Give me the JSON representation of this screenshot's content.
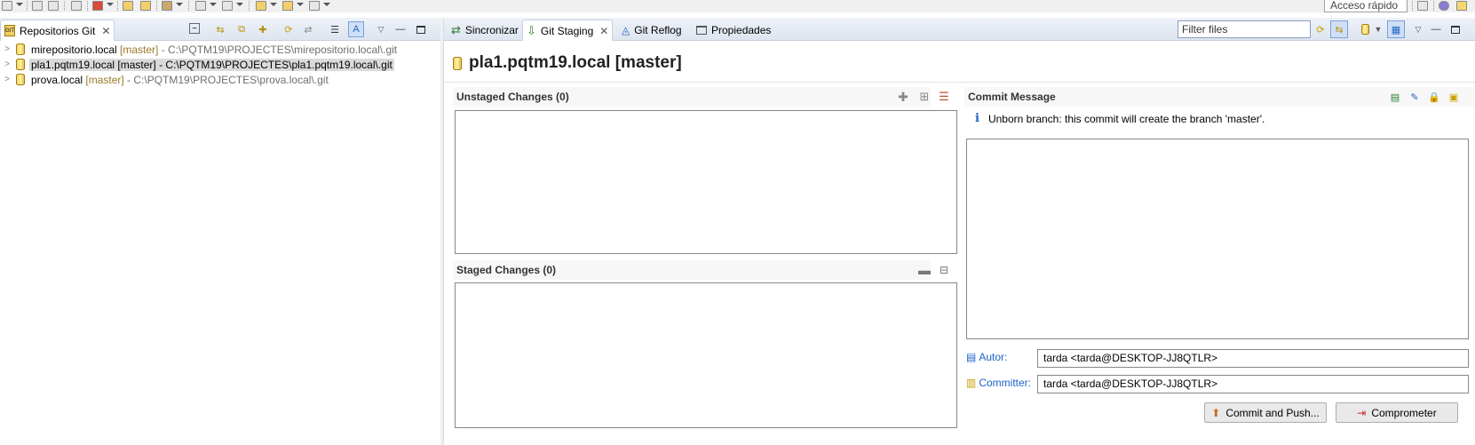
{
  "toolbar": {
    "quick_access": "Acceso rápido",
    "icons": [
      "new-icon",
      "save-icon",
      "save-all-icon",
      "print-icon",
      "debug-icon",
      "run-icon",
      "open-type-icon",
      "open-folder-icon",
      "tools-icon",
      "next-annotation-icon",
      "prev-annotation-icon",
      "back-icon",
      "forward-icon"
    ],
    "right_icons": [
      "open-perspective-icon",
      "git-perspective-icon",
      "java-perspective-icon"
    ]
  },
  "left_view": {
    "tab_label": "Repositorios Git",
    "tab_close": "✕",
    "actions": [
      "collapse-all-icon",
      "link-with-selection-icon",
      "clone-repo-icon",
      "add-repo-icon",
      "create-repo-icon",
      "refresh-icon",
      "expand-icon",
      "flat-layout-icon",
      "hierarchical-layout-icon",
      "view-menu-icon",
      "minimize-icon",
      "maximize-icon"
    ],
    "repos": [
      {
        "name": "mirepositorio.local",
        "branch": "[master]",
        "path": " - C:\\PQTM19\\PROJECTES\\mirepositorio.local\\.git",
        "selected": false
      },
      {
        "name": "pla1.pqtm19.local",
        "branch": "[master]",
        "path": " - C:\\PQTM19\\PROJECTES\\pla1.pqtm19.local\\.git",
        "selected": true
      },
      {
        "name": "prova.local",
        "branch": "[master]",
        "path": " - C:\\PQTM19\\PROJECTES\\prova.local\\.git",
        "selected": false
      }
    ]
  },
  "right_view": {
    "tabs": [
      {
        "label": "Sincronizar",
        "active": false
      },
      {
        "label": "Git Staging",
        "active": true
      },
      {
        "label": "Git Reflog",
        "active": false
      },
      {
        "label": "Propiedades",
        "active": false
      }
    ],
    "tab_close": "✕",
    "filter_placeholder": "Filter files",
    "repo_title": "pla1.pqtm19.local [master]",
    "unstaged_header": "Unstaged Changes (0)",
    "staged_header": "Staged Changes (0)",
    "commit_header": "Commit Message",
    "info_message": "Unborn branch: this commit will create the branch 'master'.",
    "author_label": "Autor:",
    "author_value": "tarda <tarda@DESKTOP-JJ8QTLR>",
    "committer_label": "Committer:",
    "committer_value": "tarda <tarda@DESKTOP-JJ8QTLR>",
    "commit_push_label": "Commit and Push...",
    "commit_label": "Comprometer"
  }
}
